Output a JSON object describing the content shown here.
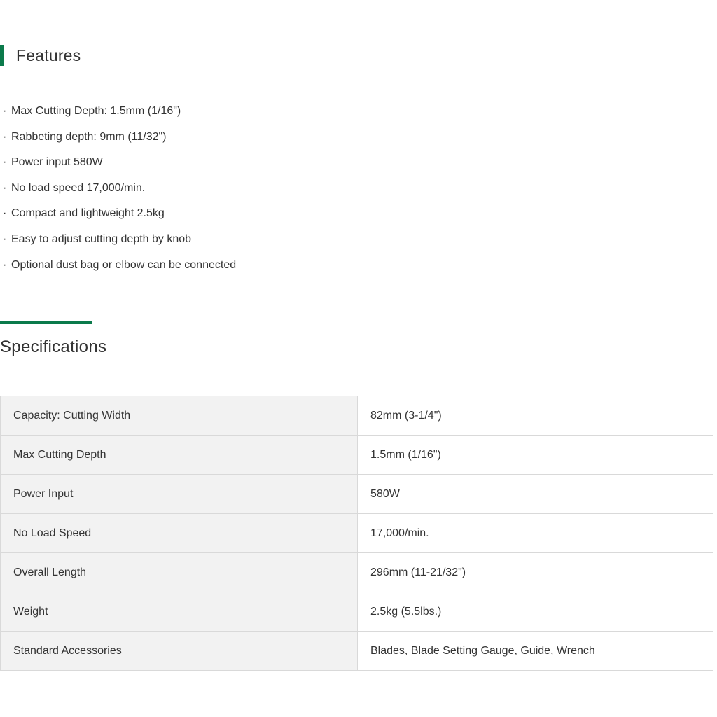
{
  "features": {
    "title": "Features",
    "bullet": "·",
    "items": [
      "Max Cutting Depth: 1.5mm (1/16\")",
      "Rabbeting depth: 9mm (11/32\")",
      "Power input 580W",
      "No load speed 17,000/min.",
      "Compact and lightweight 2.5kg",
      "Easy to adjust cutting depth by knob",
      "Optional dust bag or elbow can be connected"
    ]
  },
  "specifications": {
    "title": "Specifications",
    "rows": [
      {
        "label": "Capacity: Cutting Width",
        "value": "82mm (3-1/4\")"
      },
      {
        "label": "Max Cutting Depth",
        "value": "1.5mm (1/16\")"
      },
      {
        "label": "Power Input",
        "value": "580W"
      },
      {
        "label": "No Load Speed",
        "value": "17,000/min."
      },
      {
        "label": "Overall Length",
        "value": "296mm (11-21/32\")"
      },
      {
        "label": "Weight",
        "value": "2.5kg (5.5lbs.)"
      },
      {
        "label": "Standard Accessories",
        "value": "Blades, Blade Setting Gauge, Guide, Wrench"
      }
    ]
  },
  "colors": {
    "accent": "#0b7a4b",
    "label_cell_bg": "#f2f2f2",
    "border": "#d9d9d9",
    "text": "#333333"
  }
}
